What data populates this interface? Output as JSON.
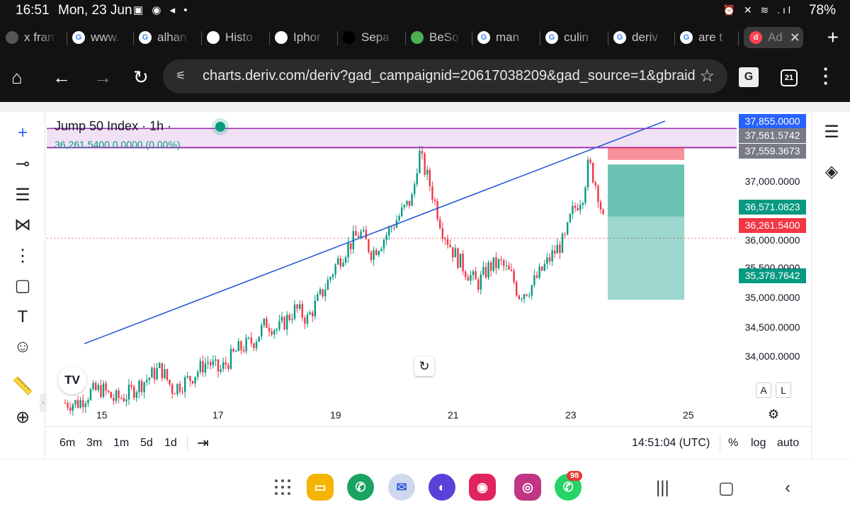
{
  "status": {
    "time": "16:51",
    "date": "Mon, 23 Jun",
    "left_icons": "▣ ◉ ◂ •",
    "right_icons": "⏰ ✕ ≋ .ıl",
    "battery": "78%"
  },
  "tabs": [
    {
      "label": "x fran",
      "icon": "circle-icon",
      "color": "#555555"
    },
    {
      "label": "www.",
      "icon": "google-icon",
      "color": "#ffffff"
    },
    {
      "label": "alhan",
      "icon": "google-icon",
      "color": "#ffffff"
    },
    {
      "label": "Histo",
      "icon": "chrome-history-icon",
      "color": "#ffffff"
    },
    {
      "label": "Iphor",
      "icon": "doc-icon",
      "color": "#ffffff"
    },
    {
      "label": "Sepa",
      "icon": "audio-icon",
      "color": "#000000"
    },
    {
      "label": "BeSo",
      "icon": "green-icon",
      "color": "#4caf50"
    },
    {
      "label": "man",
      "icon": "google-icon",
      "color": "#ffffff"
    },
    {
      "label": "culin",
      "icon": "google-icon",
      "color": "#ffffff"
    },
    {
      "label": "deriv",
      "icon": "google-icon",
      "color": "#ffffff"
    },
    {
      "label": "are t",
      "icon": "google-icon",
      "color": "#ffffff"
    },
    {
      "label": "Ad",
      "icon": "deriv-icon",
      "color": "#ff444f",
      "active": true
    }
  ],
  "address": {
    "url": "charts.deriv.com/deriv?gad_campaignid=20617038209&gad_source=1&gbraid",
    "tab_count": "21"
  },
  "chart_header": {
    "title": "Jump 50 Index · 1h ·",
    "quote": "36,261.5400  0.0000 (0.00%)"
  },
  "price_labels": [
    {
      "text": "37,855.0000",
      "bg": "#2962ff"
    },
    {
      "text": "37,561.5742",
      "bg": "#787b86"
    },
    {
      "text": "37,559.3673",
      "bg": "#787b86"
    },
    {
      "text": "36,571.0823",
      "bg": "#089981"
    },
    {
      "text": "36,261.5400",
      "bg": "#f23645"
    },
    {
      "text": "35,378.7642",
      "bg": "#089981"
    }
  ],
  "price_ticks": [
    "37,000.0000",
    "36,000.0000",
    "35,500.0000",
    "35,000.0000",
    "34,500.0000",
    "34,000.0000"
  ],
  "date_ticks": [
    "15",
    "17",
    "19",
    "21",
    "23",
    "25"
  ],
  "scale_buttons": [
    "A",
    "L"
  ],
  "bottom_bar": {
    "ranges": [
      "6m",
      "3m",
      "1m",
      "5d",
      "1d"
    ],
    "clock": "14:51:04 (UTC)",
    "percent": "%",
    "log": "log",
    "auto": "auto"
  },
  "dock_badge": "98",
  "chart_data": {
    "type": "candlestick",
    "title": "Jump 50 Index · 1h ·",
    "x_ticks": [
      "15",
      "17",
      "19",
      "21",
      "23",
      "25"
    ],
    "y_ticks": [
      34000,
      34500,
      35000,
      35500,
      36000,
      37000
    ],
    "ylim": [
      33850,
      37950
    ],
    "last_price": 36261.54,
    "marked_levels": [
      37855.0,
      37561.5742,
      37559.3673,
      36571.0823,
      36261.54,
      35378.7642
    ],
    "trend_line": [
      [
        14.7,
        34750
      ],
      [
        24.6,
        37940
      ]
    ],
    "position": {
      "side": "short",
      "entry": 36571.0823,
      "stop": 37561.5742,
      "target": 35378.7642
    },
    "close_path": [
      [
        14.6,
        33900
      ],
      [
        14.8,
        34050
      ],
      [
        15.0,
        34100
      ],
      [
        15.2,
        33950
      ],
      [
        15.4,
        34000
      ],
      [
        15.7,
        34200
      ],
      [
        16.0,
        34400
      ],
      [
        16.2,
        34100
      ],
      [
        16.5,
        34250
      ],
      [
        16.8,
        34500
      ],
      [
        17.0,
        34350
      ],
      [
        17.3,
        34650
      ],
      [
        17.6,
        34800
      ],
      [
        17.8,
        35050
      ],
      [
        18.0,
        34950
      ],
      [
        18.3,
        35250
      ],
      [
        18.5,
        35100
      ],
      [
        18.8,
        35550
      ],
      [
        19.0,
        35900
      ],
      [
        19.2,
        36150
      ],
      [
        19.4,
        36350
      ],
      [
        19.6,
        36050
      ],
      [
        19.8,
        36250
      ],
      [
        20.0,
        36500
      ],
      [
        20.3,
        36850
      ],
      [
        20.4,
        37500
      ],
      [
        20.6,
        37000
      ],
      [
        20.8,
        36400
      ],
      [
        21.0,
        36050
      ],
      [
        21.2,
        35800
      ],
      [
        21.4,
        35600
      ],
      [
        21.6,
        35850
      ],
      [
        21.8,
        35900
      ],
      [
        22.0,
        35700
      ],
      [
        22.1,
        35450
      ],
      [
        22.3,
        35550
      ],
      [
        22.5,
        35800
      ],
      [
        22.7,
        36050
      ],
      [
        22.9,
        36250
      ],
      [
        23.0,
        36600
      ],
      [
        23.2,
        36900
      ],
      [
        23.3,
        37350
      ],
      [
        23.45,
        36950
      ],
      [
        23.6,
        36262
      ]
    ]
  }
}
